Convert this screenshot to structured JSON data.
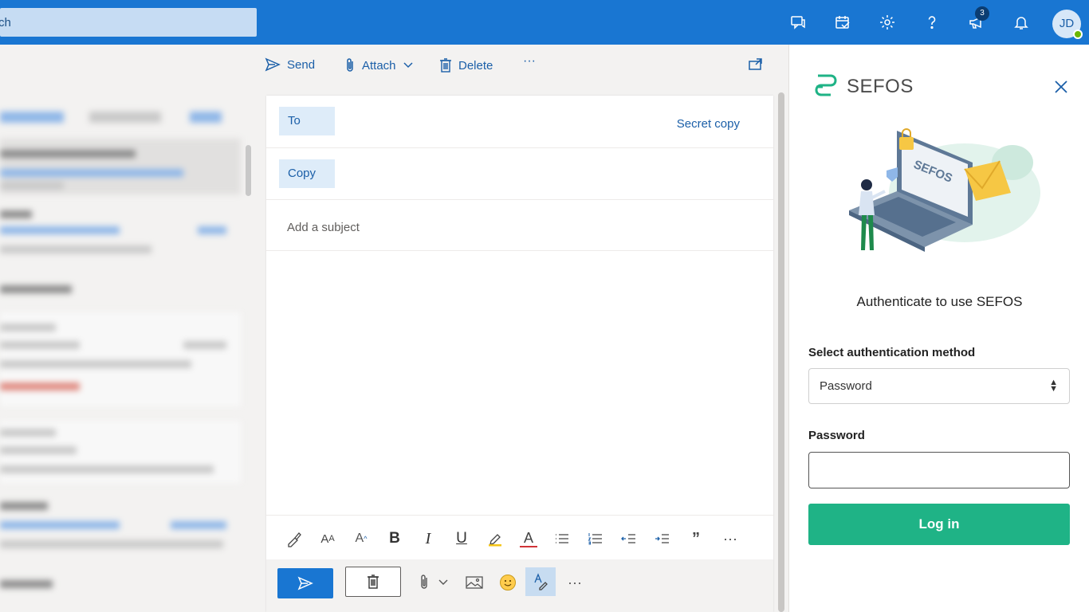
{
  "topbar": {
    "search_text": "ch",
    "badge_count": "3",
    "avatar_initials": "JD",
    "accent": "#1976d2"
  },
  "toolbar": {
    "send_label": "Send",
    "attach_label": "Attach",
    "delete_label": "Delete",
    "more_label": "···"
  },
  "compose": {
    "to_label": "To",
    "secret_copy_label": "Secret copy",
    "copy_label": "Copy",
    "subject_placeholder": "Add a subject"
  },
  "format": {
    "bold": "B",
    "italic": "I",
    "underline": "U",
    "font_color": "A",
    "quote": "”",
    "more": "···"
  },
  "actionbar": {
    "more": "···"
  },
  "sefos": {
    "brand": "SEFOS",
    "auth_title": "Authenticate to use SEFOS",
    "method_label": "Select authentication method",
    "method_value": "Password",
    "password_label": "Password",
    "login_label": "Log in",
    "brand_color": "#1fb386"
  }
}
